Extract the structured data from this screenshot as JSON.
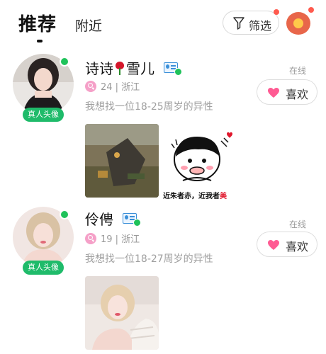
{
  "header": {
    "tab_active": "推荐",
    "tab_inactive": "附近",
    "filter_label": "筛选",
    "filter_icon": "funnel-icon",
    "gift_icon": "red-envelope-icon"
  },
  "colors": {
    "online_green": "#1fc25a",
    "badge_green": "#1fbb6a",
    "heart_pink": "#ff5b93",
    "notification_red": "#ff5a4e"
  },
  "users": [
    {
      "name_part1": "诗诗",
      "name_part2": "雪儿",
      "name_emoji": "rose-icon",
      "verified_icon": "id-verified-icon",
      "real_avatar_badge": "真人头像",
      "age_location": "24 | 浙江",
      "wish": "我想找一位18-25周岁的异性",
      "status": "在线",
      "like_label": "喜欢",
      "sticker_caption_main": "近朱者赤，近我者",
      "sticker_caption_accent": "美"
    },
    {
      "name_part1": "伶俜",
      "verified_icon": "id-verified-icon",
      "real_avatar_badge": "真人头像",
      "age_location": "19 | 浙江",
      "wish": "我想找一位18-27周岁的异性",
      "status": "在线",
      "like_label": "喜欢"
    }
  ]
}
